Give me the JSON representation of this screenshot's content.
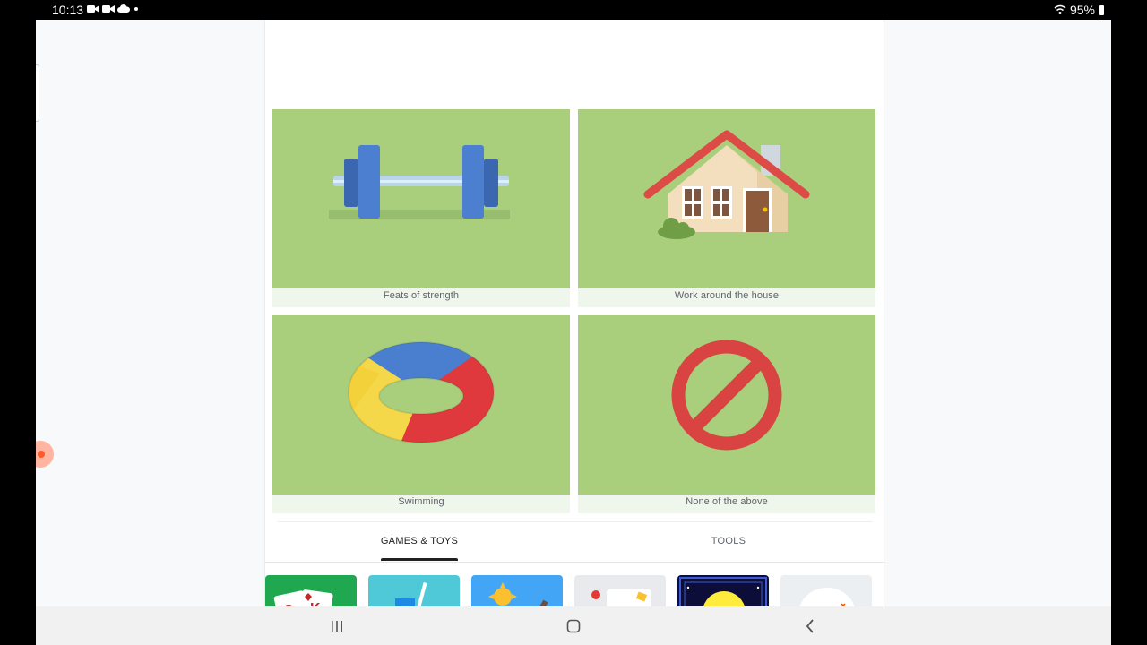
{
  "status_bar": {
    "time": "10:13",
    "battery": "95%",
    "icons": [
      "video-icon",
      "video-icon",
      "cloud-icon",
      "dot-icon",
      "wifi-icon",
      "battery-icon"
    ]
  },
  "options": [
    {
      "label": "Feats of strength",
      "icon": "dumbbell-icon"
    },
    {
      "label": "Work around the house",
      "icon": "house-icon"
    },
    {
      "label": "Swimming",
      "icon": "swim-ring-icon"
    },
    {
      "label": "None of the above",
      "icon": "prohibited-icon"
    }
  ],
  "tabs": {
    "games": "GAMES & TOYS",
    "tools": "TOOLS",
    "selected": "games"
  },
  "app_tiles": [
    "solitaire-app-icon",
    "drink-app-icon",
    "weather-game-app-icon",
    "paper-app-icon",
    "pac-man-app-icon",
    "misc-app-icon"
  ],
  "nav_bar": {
    "icons": [
      "recent-apps-icon",
      "home-icon",
      "back-icon"
    ]
  },
  "colors": {
    "card_green": "#a9cf7c",
    "caption_bg": "#eff6ec"
  }
}
